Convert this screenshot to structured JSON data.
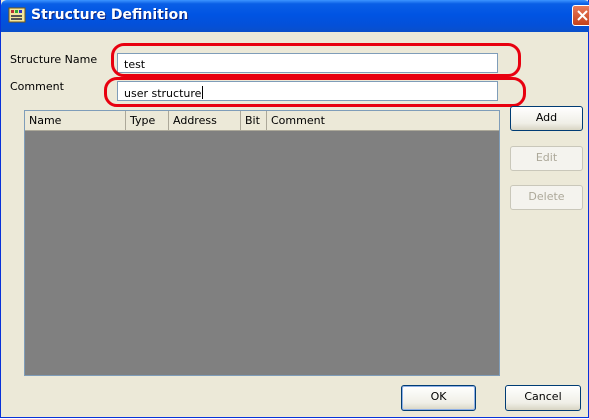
{
  "window": {
    "title": "Structure Definition"
  },
  "form": {
    "structure_name_label": "Structure Name",
    "structure_name_value": "test",
    "comment_label": "Comment",
    "comment_value": "user structure"
  },
  "table": {
    "columns": [
      "Name",
      "Type",
      "Address",
      "Bit",
      "Comment"
    ],
    "rows": []
  },
  "side_buttons": {
    "add": "Add",
    "edit": "Edit",
    "delete": "Delete"
  },
  "bottom_buttons": {
    "ok": "OK",
    "cancel": "Cancel"
  },
  "highlight_color": "#e8000f",
  "icons": {
    "app": "struct-app-icon",
    "close": "close-icon"
  }
}
